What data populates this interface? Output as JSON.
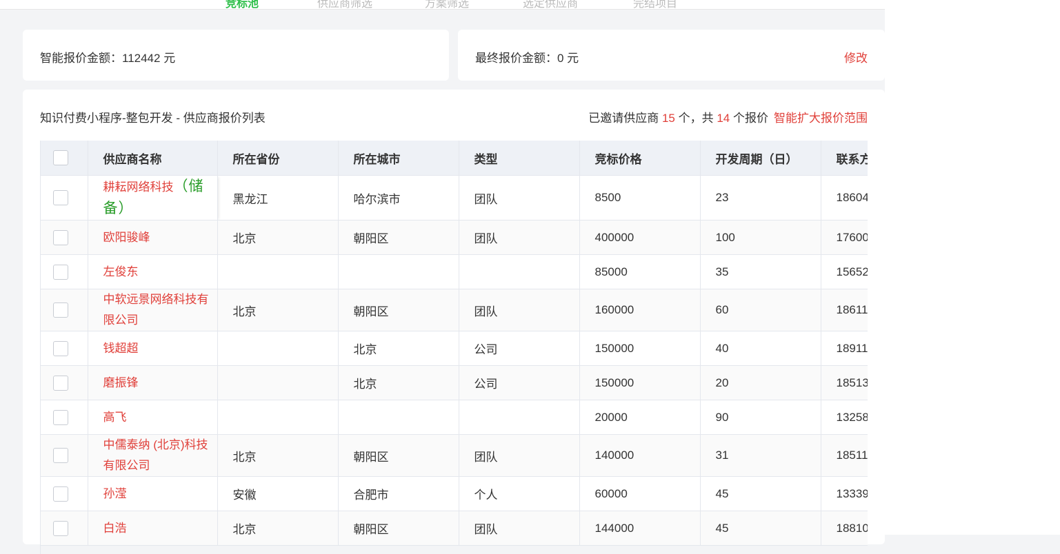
{
  "topnav": {
    "tabs": [
      "竞标池",
      "供应商筛选",
      "方案筛选",
      "选定供应商",
      "完结项目"
    ]
  },
  "quote": {
    "smart_label": "智能报价金额：112442 元",
    "final_label": "最终报价金额：0 元",
    "edit_label": "修改"
  },
  "list": {
    "title": "知识付费小程序-整包开发 - 供应商报价列表",
    "invited_prefix": "已邀请供应商 ",
    "invited_count": "15",
    "invited_mid": " 个，共 ",
    "quote_count": "14",
    "invited_suffix": " 个报价",
    "expand_label": "智能扩大报价范围"
  },
  "table": {
    "headers": [
      "供应商名称",
      "所在省份",
      "所在城市",
      "类型",
      "竞标价格",
      "开发周期（日）",
      "联系方式"
    ],
    "reserve_tag": "（储备）",
    "rows": [
      {
        "name": "耕耘网络科技",
        "province": "黑龙江",
        "city": "哈尔滨市",
        "type": "团队",
        "price": "8500",
        "period": "23",
        "contact": "18604"
      },
      {
        "name": "欧阳骏峰",
        "province": "北京",
        "city": "朝阳区",
        "type": "团队",
        "price": "400000",
        "period": "100",
        "contact": "17600"
      },
      {
        "name": "左俊东",
        "province": "",
        "city": "",
        "type": "",
        "price": "85000",
        "period": "35",
        "contact": "15652"
      },
      {
        "name": "中软远景网络科技有限公司",
        "province": "北京",
        "city": "朝阳区",
        "type": "团队",
        "price": "160000",
        "period": "60",
        "contact": "18611"
      },
      {
        "name": "钱超超",
        "province": "",
        "city": "北京",
        "type": "公司",
        "price": "150000",
        "period": "40",
        "contact": "18911"
      },
      {
        "name": "磨振锋",
        "province": "",
        "city": "北京",
        "type": "公司",
        "price": "150000",
        "period": "20",
        "contact": "18513"
      },
      {
        "name": "高飞",
        "province": "",
        "city": "",
        "type": "",
        "price": "20000",
        "period": "90",
        "contact": "13258"
      },
      {
        "name": "中儒泰纳 (北京)科技有限公司",
        "province": "北京",
        "city": "朝阳区",
        "type": "团队",
        "price": "140000",
        "period": "31",
        "contact": "18511"
      },
      {
        "name": "孙滢",
        "province": "安徽",
        "city": "合肥市",
        "type": "个人",
        "price": "60000",
        "period": "45",
        "contact": "13339"
      },
      {
        "name": "白浩",
        "province": "北京",
        "city": "朝阳区",
        "type": "团队",
        "price": "144000",
        "period": "45",
        "contact": "18810"
      }
    ]
  }
}
